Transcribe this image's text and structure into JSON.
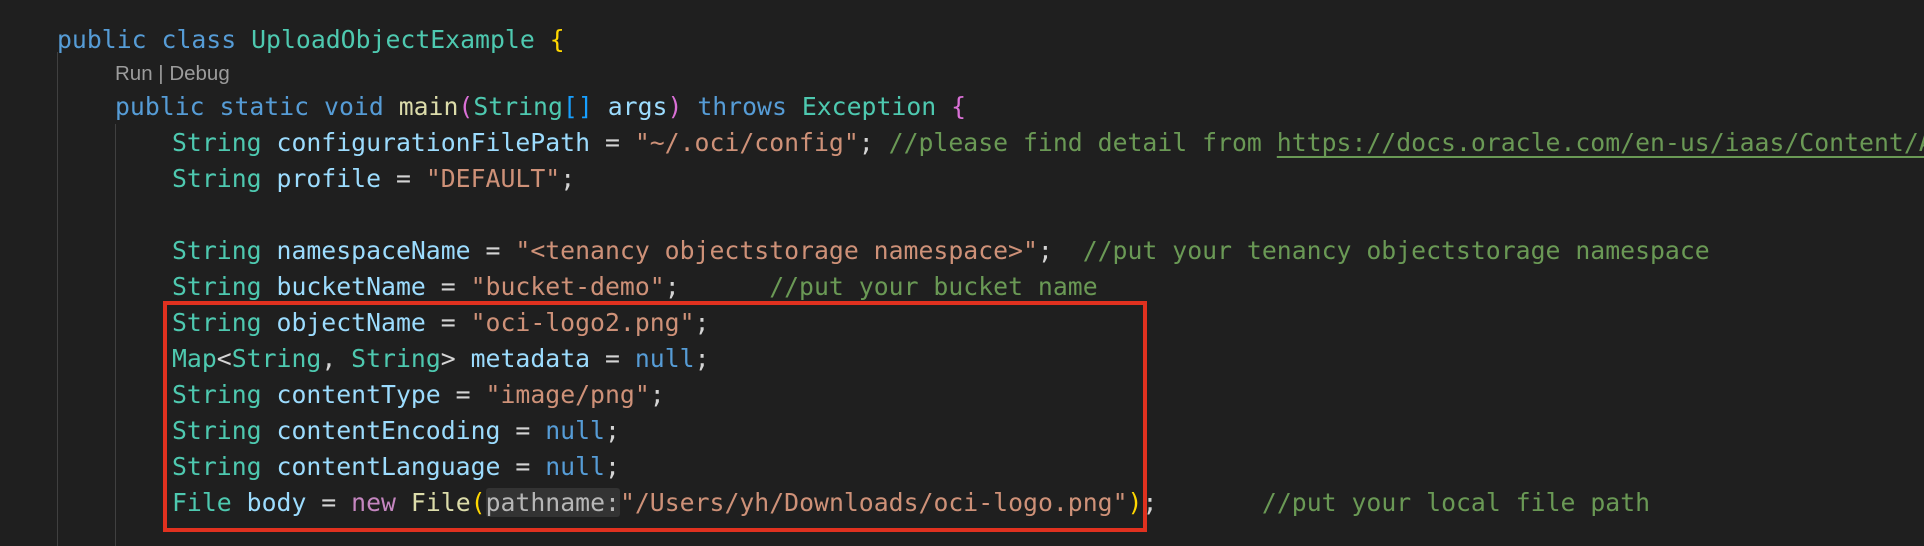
{
  "code_lens": {
    "run": "Run",
    "separator": " | ",
    "debug": "Debug"
  },
  "lines": {
    "l1": {
      "kw1": "public",
      "kw2": "class",
      "class_name": "UploadObjectExample",
      "brace": "{"
    },
    "l2": {
      "kw1": "public",
      "kw2": "static",
      "kw3": "void",
      "method": "main",
      "paren_open": "(",
      "type": "String",
      "brackets": "[]",
      "param": "args",
      "paren_close": ")",
      "kw4": "throws",
      "exception": "Exception",
      "brace": "{"
    },
    "l3": {
      "type": "String",
      "var": "configurationFilePath",
      "eq": " = ",
      "value": "\"~/.oci/config\"",
      "semi": ";",
      "comment": "//please find detail from ",
      "link": "https://docs.oracle.com/en-us/iaas/Content/API/"
    },
    "l4": {
      "type": "String",
      "var": "profile",
      "eq": " = ",
      "value": "\"DEFAULT\"",
      "semi": ";"
    },
    "l5": {
      "type": "String",
      "var": "namespaceName",
      "eq": " = ",
      "value": "\"<tenancy objectstorage namespace>\"",
      "semi": ";",
      "comment": "//put your tenancy objectstorage namespace"
    },
    "l6": {
      "type": "String",
      "var": "bucketName",
      "eq": " = ",
      "value": "\"bucket-demo\"",
      "semi": ";",
      "comment": "//put your bucket name"
    },
    "l7": {
      "type": "String",
      "var": "objectName",
      "eq": " = ",
      "value": "\"oci-logo2.png\"",
      "semi": ";"
    },
    "l8": {
      "type": "Map",
      "lt": "<",
      "t1": "String",
      "comma": ", ",
      "t2": "String",
      "gt": ">",
      "var": "metadata",
      "eq": " = ",
      "value": "null",
      "semi": ";"
    },
    "l9": {
      "type": "String",
      "var": "contentType",
      "eq": " = ",
      "value": "\"image/png\"",
      "semi": ";"
    },
    "l10": {
      "type": "String",
      "var": "contentEncoding",
      "eq": " = ",
      "value": "null",
      "semi": ";"
    },
    "l11": {
      "type": "String",
      "var": "contentLanguage",
      "eq": " = ",
      "value": "null",
      "semi": ";"
    },
    "l12": {
      "type": "File",
      "var": "body",
      "eq": " = ",
      "kw": "new",
      "ctor": "File",
      "paren_open": "(",
      "hint": "pathname:",
      "value": "\"/Users/yh/Downloads/oci-logo.png\"",
      "paren_close": ")",
      "semi": ";",
      "comment": "//put your local file path"
    }
  },
  "colors": {
    "background": "#1f1f1f",
    "keyword": "#569cd6",
    "control_keyword": "#c586c0",
    "type": "#4ec9b0",
    "variable": "#9cdcfe",
    "function": "#dcdcaa",
    "string": "#ce9178",
    "comment": "#6a9955",
    "highlight_box": "#e0311f"
  }
}
